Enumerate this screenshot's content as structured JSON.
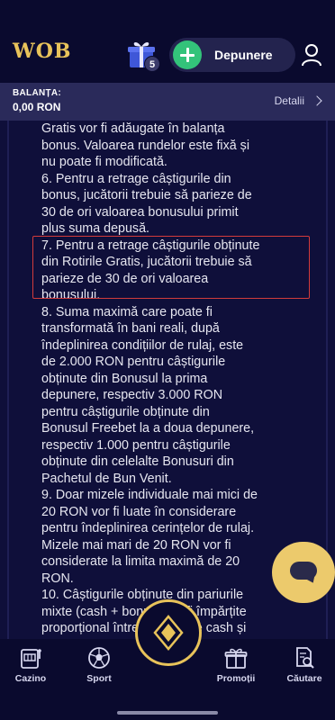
{
  "header": {
    "logo_text": "WOB",
    "gift_badge_count": "5",
    "deposit_label": "Depunere"
  },
  "balance": {
    "label": "BALANȚA:",
    "value": "0,00 RON",
    "details_label": "Detalii"
  },
  "terms": {
    "text": "Gratis vor fi adăugate în balanța\nbonus. Valoarea rundelor este fixă și\nnu poate fi modificată.\n6. Pentru a retrage câștigurile din\nbonus, jucătorii trebuie să parieze de\n30 de ori valoarea bonusului primit\nplus suma depusă.\n7. Pentru a retrage câștigurile obținute\ndin Rotirile Gratis, jucătorii trebuie să\nparieze de 30 de ori valoarea\nbonusului.\n8. Suma maximă care poate fi\ntransformată în bani reali, după\nîndeplinirea condițiilor de rulaj, este\nde 2.000 RON pentru câștigurile\nobținute din Bonusul la prima\ndepunere, respectiv 3.000 RON\npentru câștigurile obținute din\nBonusul Freebet la a doua depunere,\nrespectiv 1.000 pentru câștigurile\nobținute din celelalte Bonusuri din\nPachetul de Bun Venit.\n9. Doar mizele individuale mai mici de\n20 RON vor fi luate în considerare\npentru îndeplinirea cerințelor de rulaj.\nMizele mai mari de 20 RON vor fi\nconsiderate la limita maximă de 20\nRON.\n10. Câștigurile obținute din pariurile\nmixte (cash + bonus) vor fi împărțite\nproporțional între balanța de cash și\nbalanța de bonus. De exemplu, pentru"
  },
  "nav": {
    "items": [
      {
        "label": "Cazino",
        "icon": "slot-machine-icon"
      },
      {
        "label": "Sport",
        "icon": "soccer-ball-icon"
      },
      {
        "label": "",
        "icon": "diamond-logo-icon"
      },
      {
        "label": "Promoții",
        "icon": "gift-icon"
      },
      {
        "label": "Căutare",
        "icon": "search-document-icon"
      }
    ]
  },
  "colors": {
    "background": "#0f0f3a",
    "header": "#0a0a2e",
    "balance_bar": "#2a2a5a",
    "accent_gold": "#e8c35a",
    "deposit_green": "#33c37a",
    "highlight_red": "#d23b3b"
  }
}
